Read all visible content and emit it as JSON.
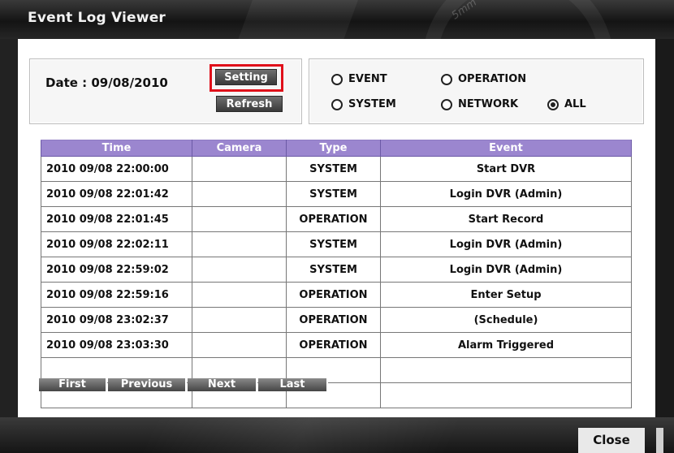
{
  "window": {
    "title": "Event Log Viewer",
    "watermark": "5mm"
  },
  "date_panel": {
    "date_label": "Date : 09/08/2010",
    "setting_label": "Setting",
    "refresh_label": "Refresh",
    "highlight_color": "#e0101a"
  },
  "filters": {
    "event": "EVENT",
    "operation": "OPERATION",
    "system": "SYSTEM",
    "network": "NETWORK",
    "all": "ALL",
    "selected": "ALL"
  },
  "table": {
    "header_color": "#9b86cf",
    "columns": [
      "Time",
      "Camera",
      "Type",
      "Event"
    ],
    "rows": [
      {
        "time": "2010 09/08 22:00:00",
        "camera": "",
        "type": "SYSTEM",
        "event": "Start DVR"
      },
      {
        "time": "2010 09/08 22:01:42",
        "camera": "",
        "type": "SYSTEM",
        "event": "Login DVR (Admin)"
      },
      {
        "time": "2010 09/08 22:01:45",
        "camera": "",
        "type": "OPERATION",
        "event": "Start Record"
      },
      {
        "time": "2010 09/08 22:02:11",
        "camera": "",
        "type": "SYSTEM",
        "event": "Login DVR (Admin)"
      },
      {
        "time": "2010 09/08 22:59:02",
        "camera": "",
        "type": "SYSTEM",
        "event": "Login DVR (Admin)"
      },
      {
        "time": "2010 09/08 22:59:16",
        "camera": "",
        "type": "OPERATION",
        "event": "Enter Setup"
      },
      {
        "time": "2010 09/08 23:02:37",
        "camera": "",
        "type": "OPERATION",
        "event": "(Schedule)"
      },
      {
        "time": "2010 09/08 23:03:30",
        "camera": "",
        "type": "OPERATION",
        "event": "Alarm Triggered"
      },
      {
        "time": "",
        "camera": "",
        "type": "",
        "event": ""
      },
      {
        "time": "",
        "camera": "",
        "type": "",
        "event": ""
      }
    ]
  },
  "pager": {
    "first": "First",
    "previous": "Previous",
    "next": "Next",
    "last": "Last"
  },
  "footer": {
    "close_label": "Close"
  }
}
